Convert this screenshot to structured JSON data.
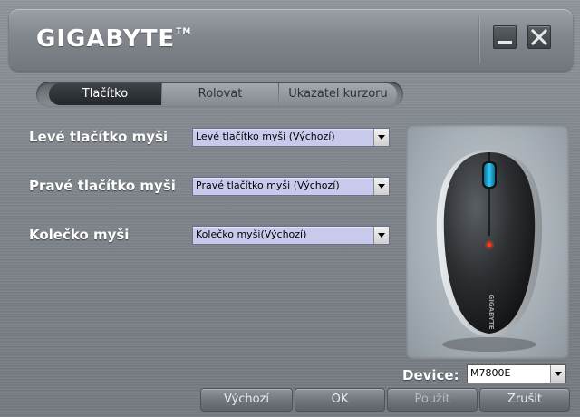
{
  "header": {
    "brand": "GIGABYTE",
    "brand_tm": "TM",
    "icons": {
      "minimize": "minimize-icon",
      "close": "close-icon"
    }
  },
  "tabs": [
    {
      "label": "Tlačítko",
      "active": true
    },
    {
      "label": "Rolovat",
      "active": false
    },
    {
      "label": "Ukazatel kurzoru",
      "active": false
    }
  ],
  "settings": {
    "left_button": {
      "label": "Levé tlačítko myši",
      "value": "Levé tlačítko myši (Výchozí)"
    },
    "right_button": {
      "label": "Pravé tlačítko myši",
      "value": "Pravé tlačítko myši (Výchozí)"
    },
    "wheel": {
      "label": "Kolečko myši",
      "value": "Kolečko myši(Výchozí)"
    }
  },
  "device": {
    "label": "Device:",
    "value": "M7800E"
  },
  "buttons": {
    "default": "Výchozí",
    "ok": "OK",
    "apply": "Použít",
    "cancel": "Zrušit"
  },
  "mouse_image": {
    "brand_text": "GIGABYTE",
    "icon": "mouse-image"
  },
  "colors": {
    "select_bg": "#c9c9ec",
    "active_tab": "#2b2f33",
    "accent_blue": "#1fb4e8",
    "led_red": "#ff3a1a"
  }
}
